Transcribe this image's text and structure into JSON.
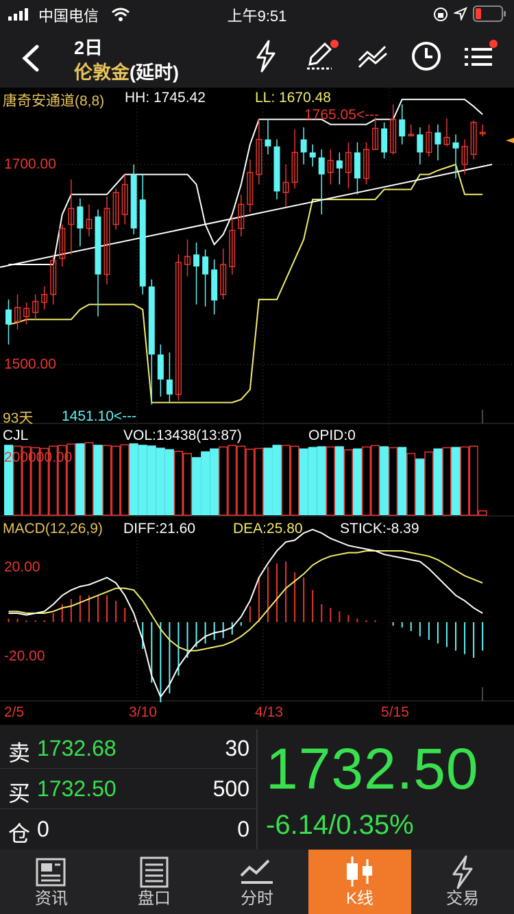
{
  "status_bar": {
    "carrier": "中国电信",
    "time": "上午9:51"
  },
  "header": {
    "period": "2日",
    "instrument": "伦敦金",
    "delay_tag": "(延时)"
  },
  "indicator": {
    "name": "唐奇安通道(8,8)",
    "hh": "HH: 1745.42",
    "ll": "LL: 1670.48"
  },
  "price_axis": {
    "label_1700": "1700.00",
    "label_1500": "1500.00"
  },
  "annotations": {
    "high_marker": "1765.05<---",
    "low_marker": "1451.10<---",
    "days": "93天"
  },
  "volume_panel": {
    "name": "CJL",
    "vol": "VOL:13438(13:87)",
    "opid": "OPID:0",
    "axis_label": "200000.00"
  },
  "macd_panel": {
    "name": "MACD(12,26,9)",
    "diff": "DIFF:21.60",
    "dea": "DEA:25.80",
    "stick": "STICK:-8.39",
    "axis_top": "20.00",
    "axis_bottom": "-20.00"
  },
  "date_axis": [
    "2/5",
    "3/10",
    "4/13",
    "5/15"
  ],
  "quote": {
    "sell_label": "卖",
    "sell_price": "1732.68",
    "sell_qty": "30",
    "buy_label": "买",
    "buy_price": "1732.50",
    "buy_qty": "500",
    "pos_label": "仓",
    "pos_value": "0",
    "pos_qty": "0",
    "last_price": "1732.50",
    "change": "-6.14/0.35%"
  },
  "tabs": [
    {
      "label": "资讯",
      "icon": "news-icon",
      "active": false
    },
    {
      "label": "盘口",
      "icon": "orderbook-icon",
      "active": false
    },
    {
      "label": "分时",
      "icon": "timeshare-icon",
      "active": false
    },
    {
      "label": "K线",
      "icon": "candlestick-icon",
      "active": true
    },
    {
      "label": "交易",
      "icon": "lightning-icon",
      "active": false
    }
  ],
  "colors": {
    "up": "#e8362f",
    "down": "#5ff3f3",
    "upper_band": "#ffffff",
    "lower_band": "#f2ec6a",
    "accent_tab": "#f07a2a",
    "price_green": "#38e04e"
  },
  "chart_data": {
    "type": "candlestick",
    "price_axis_labels": [
      1700.0,
      1500.0
    ],
    "high_annotation": 1765.05,
    "low_annotation": 1451.1,
    "date_labels": [
      "2/5",
      "3/10",
      "4/13",
      "5/15"
    ],
    "candles": [
      [
        1555,
        1540,
        1565,
        1520
      ],
      [
        1543,
        1557,
        1570,
        1535
      ],
      [
        1548,
        1556,
        1562,
        1540
      ],
      [
        1552,
        1563,
        1570,
        1545
      ],
      [
        1562,
        1570,
        1578,
        1555
      ],
      [
        1570,
        1604,
        1610,
        1560
      ],
      [
        1606,
        1636,
        1640,
        1598
      ],
      [
        1640,
        1656,
        1685,
        1610
      ],
      [
        1658,
        1636,
        1666,
        1618
      ],
      [
        1636,
        1645,
        1660,
        1628
      ],
      [
        1648,
        1590,
        1655,
        1548
      ],
      [
        1590,
        1656,
        1668,
        1580
      ],
      [
        1640,
        1672,
        1676,
        1635
      ],
      [
        1650,
        1680,
        1690,
        1640
      ],
      [
        1690,
        1636,
        1700,
        1630
      ],
      [
        1665,
        1578,
        1690,
        1570
      ],
      [
        1578,
        1510,
        1585,
        1460
      ],
      [
        1510,
        1485,
        1520,
        1468
      ],
      [
        1485,
        1470,
        1512,
        1462
      ],
      [
        1470,
        1602,
        1610,
        1464
      ],
      [
        1600,
        1608,
        1625,
        1588
      ],
      [
        1610,
        1598,
        1622,
        1560
      ],
      [
        1608,
        1590,
        1615,
        1558
      ],
      [
        1595,
        1564,
        1605,
        1550
      ],
      [
        1570,
        1600,
        1616,
        1565
      ],
      [
        1598,
        1634,
        1648,
        1590
      ],
      [
        1636,
        1660,
        1670,
        1628
      ],
      [
        1660,
        1692,
        1705,
        1652
      ],
      [
        1690,
        1725,
        1745,
        1680
      ],
      [
        1725,
        1718,
        1745,
        1710
      ],
      [
        1718,
        1673,
        1725,
        1665
      ],
      [
        1672,
        1682,
        1700,
        1658
      ],
      [
        1682,
        1712,
        1735,
        1676
      ],
      [
        1725,
        1712,
        1737,
        1700
      ],
      [
        1712,
        1707,
        1720,
        1698
      ],
      [
        1707,
        1690,
        1715,
        1650
      ],
      [
        1692,
        1704,
        1715,
        1680
      ],
      [
        1704,
        1696,
        1712,
        1680
      ],
      [
        1692,
        1712,
        1722,
        1676
      ],
      [
        1712,
        1686,
        1722,
        1670
      ],
      [
        1686,
        1715,
        1722,
        1680
      ],
      [
        1715,
        1736,
        1747,
        1715
      ],
      [
        1736,
        1712,
        1742,
        1706
      ],
      [
        1712,
        1745,
        1760,
        1710
      ],
      [
        1745,
        1728,
        1760,
        1720
      ],
      [
        1730,
        1730,
        1740,
        1728
      ],
      [
        1730,
        1712,
        1737,
        1700
      ],
      [
        1712,
        1732,
        1740,
        1708
      ],
      [
        1732,
        1720,
        1740,
        1704
      ],
      [
        1720,
        1727,
        1746,
        1718
      ],
      [
        1722,
        1716,
        1730,
        1686
      ],
      [
        1700,
        1718,
        1725,
        1690
      ],
      [
        1710,
        1742,
        1744,
        1705
      ],
      [
        1732,
        1732,
        1740,
        1728
      ]
    ],
    "upper_band": [
      1600,
      1600,
      1600,
      1600,
      1600,
      1600,
      1650,
      1670,
      1670,
      1670,
      1670,
      1670,
      1680,
      1690,
      1690,
      1690,
      1690,
      1690,
      1690,
      1690,
      1690,
      1680,
      1640,
      1620,
      1630,
      1650,
      1680,
      1720,
      1745,
      1745,
      1745,
      1745,
      1745,
      1745,
      1745,
      1745,
      1740,
      1740,
      1740,
      1740,
      1740,
      1745,
      1745,
      1745,
      1765,
      1765,
      1765,
      1765,
      1765,
      1765,
      1765,
      1765,
      1758,
      1750
    ],
    "lower_band": [
      1540,
      1542,
      1545,
      1545,
      1545,
      1545,
      1545,
      1545,
      1555,
      1560,
      1560,
      1560,
      1560,
      1560,
      1560,
      1555,
      1462,
      1462,
      1462,
      1462,
      1462,
      1462,
      1462,
      1462,
      1462,
      1462,
      1465,
      1475,
      1565,
      1565,
      1565,
      1585,
      1605,
      1625,
      1665,
      1665,
      1665,
      1665,
      1665,
      1665,
      1665,
      1665,
      1675,
      1675,
      1675,
      1675,
      1690,
      1690,
      1694,
      1697,
      1700,
      1670,
      1670,
      1670
    ],
    "trendline": [
      [
        0,
        1600
      ],
      [
        53,
        1700
      ]
    ],
    "volume": [
      0.97,
      0.95,
      0.94,
      0.93,
      0.92,
      0.95,
      0.96,
      0.98,
      0.99,
      1.0,
      0.97,
      0.96,
      0.95,
      0.97,
      0.99,
      0.97,
      0.96,
      0.93,
      0.91,
      0.88,
      0.85,
      0.8,
      0.88,
      0.92,
      0.94,
      0.96,
      0.95,
      0.91,
      0.92,
      0.93,
      0.97,
      0.96,
      0.95,
      0.92,
      0.94,
      0.95,
      0.94,
      0.95,
      0.9,
      0.92,
      0.94,
      0.96,
      0.95,
      0.93,
      0.94,
      0.85,
      0.78,
      0.87,
      0.92,
      0.93,
      0.94,
      0.94,
      0.95,
      0.06
    ],
    "macd_diff": [
      5,
      5,
      4,
      5,
      6,
      10,
      15,
      18,
      20,
      21,
      23,
      25,
      22,
      15,
      5,
      -10,
      -30,
      -42,
      -35,
      -25,
      -18,
      -12,
      -8,
      -6,
      -5,
      -3,
      3,
      12,
      25,
      33,
      40,
      45,
      46,
      50,
      52,
      50,
      47,
      45,
      43,
      42,
      41,
      40,
      38,
      37,
      36,
      35,
      34,
      30,
      25,
      20,
      15,
      12,
      8,
      5
    ],
    "macd_dea": [
      6,
      6,
      5,
      5,
      5,
      6,
      8,
      9,
      11,
      13,
      15,
      17,
      19,
      19,
      18,
      12,
      4,
      -4,
      -10,
      -14,
      -16,
      -16,
      -15,
      -14,
      -13,
      -11,
      -8,
      -4,
      1,
      7,
      13,
      19,
      23,
      27,
      32,
      35,
      37,
      38,
      39,
      39,
      40,
      40,
      40,
      40,
      40,
      39,
      38,
      37,
      35,
      32,
      29,
      26,
      24,
      22
    ],
    "macd_stick": [
      2,
      2,
      1,
      1,
      1,
      5,
      10,
      13,
      15,
      15,
      15,
      15,
      12,
      8,
      1,
      -15,
      -34,
      -45,
      -40,
      -30,
      -20,
      -14,
      -12,
      -10,
      -9,
      -7,
      -2,
      9,
      25,
      31,
      33,
      34,
      28,
      25,
      18,
      10,
      8,
      6,
      4,
      2,
      1,
      1,
      0,
      -2,
      -3,
      -5,
      -8,
      -10,
      -12,
      -14,
      -16,
      -18,
      -20,
      -16
    ]
  }
}
